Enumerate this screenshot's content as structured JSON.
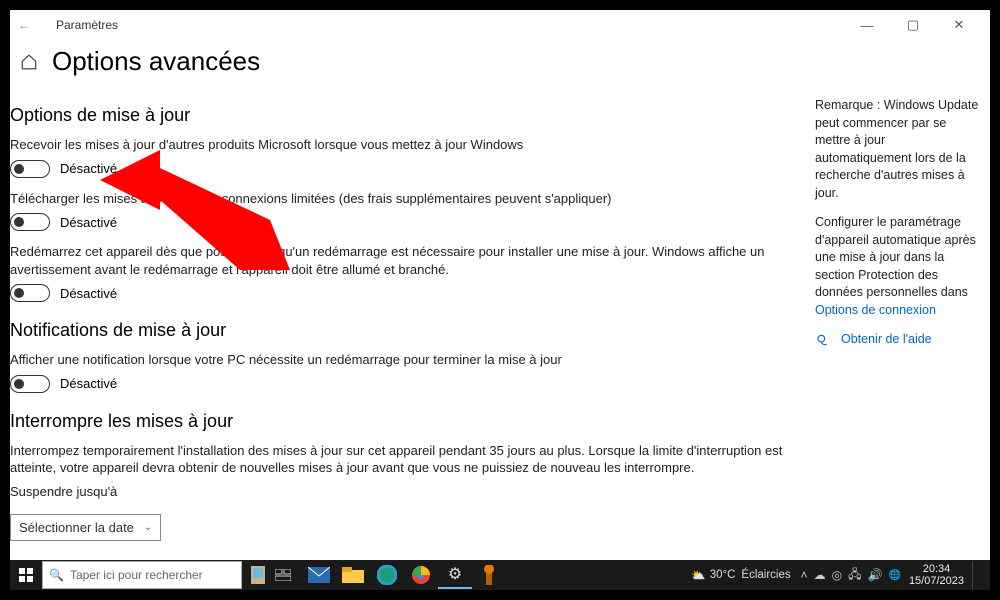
{
  "app": {
    "name": "Paramètres"
  },
  "pageTitle": "Options avancées",
  "section1": {
    "title": "Options de mise à jour",
    "opt1": {
      "label": "Recevoir les mises à jour d'autres produits Microsoft lorsque vous mettez à jour Windows",
      "state": "Désactivé"
    },
    "opt2": {
      "label": "Télécharger les mises à jour via des connexions limitées (des frais supplémentaires peuvent s'appliquer)",
      "state": "Désactivé"
    },
    "opt3": {
      "label": "Redémarrez cet appareil dès que possible lorsqu'un redémarrage est nécessaire pour installer une mise à jour. Windows affiche un avertissement avant le redémarrage et l'appareil doit être allumé et branché.",
      "state": "Désactivé"
    }
  },
  "section2": {
    "title": "Notifications de mise à jour",
    "opt1": {
      "label": "Afficher une notification lorsque votre PC nécessite un redémarrage pour terminer la mise à jour",
      "state": "Désactivé"
    }
  },
  "section3": {
    "title": "Interrompre les mises à jour",
    "desc": "Interrompez temporairement l'installation des mises à jour sur cet appareil pendant 35 jours au plus. Lorsque la limite d'interruption est atteinte, votre appareil devra obtenir de nouvelles mises à jour avant que vous ne puissiez de nouveau les interrompre.",
    "sublabel": "Suspendre jusqu'à",
    "dropdown": "Sélectionner la date"
  },
  "side": {
    "note1": "Remarque : Windows Update peut commencer par se mettre à jour automatiquement lors de la recherche d'autres mises à jour.",
    "note2": "Configurer le paramétrage d'appareil automatique après une mise à jour dans la section Protection des données personnelles dans ",
    "link1": "Options de connexion",
    "help": "Obtenir de l'aide"
  },
  "taskbar": {
    "search": "Taper ici pour rechercher",
    "weatherTemp": "30°C",
    "weatherText": "Éclaircies",
    "time": "20:34",
    "date": "15/07/2023"
  },
  "colors": {
    "link": "#0067c0",
    "arrow": "#ff0000"
  }
}
